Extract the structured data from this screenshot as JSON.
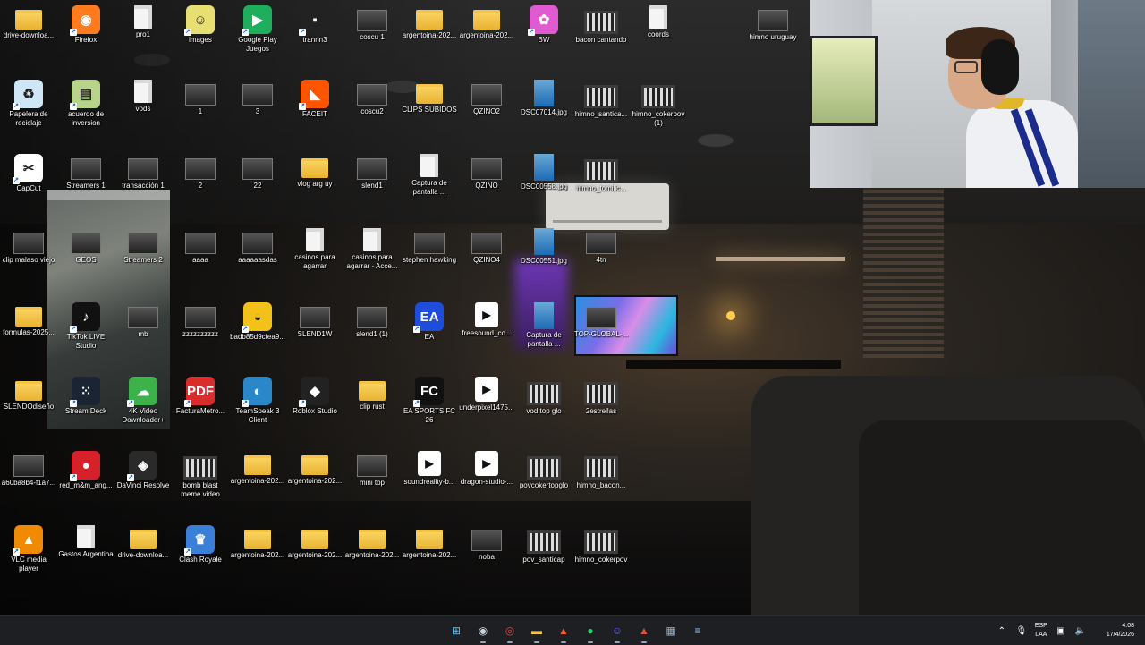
{
  "desktop": {
    "icons": [
      {
        "label": "drive-downloa...",
        "type": "folder"
      },
      {
        "label": "Firefox",
        "type": "app",
        "icon": "firefox-icon",
        "color": "#ff7b1f"
      },
      {
        "label": "pro1",
        "type": "file"
      },
      {
        "label": "images",
        "type": "app",
        "icon": "images-icon",
        "color": "#e8df72"
      },
      {
        "label": "Google Play Juegos",
        "type": "app",
        "icon": "google-play-games-icon",
        "color": "#1fae5c"
      },
      {
        "label": "trannn3",
        "type": "app",
        "icon": "trannn3-icon",
        "color": "#222"
      },
      {
        "label": "coscu 1",
        "type": "thumb"
      },
      {
        "label": "argentoina-202...",
        "type": "folder"
      },
      {
        "label": "argentoina-202...",
        "type": "folder"
      },
      {
        "label": "BW",
        "type": "app",
        "icon": "bw-icon",
        "color": "#e05ad1"
      },
      {
        "label": "bacon cantando",
        "type": "video"
      },
      {
        "label": "coords",
        "type": "file"
      },
      {
        "label": "himno uruguay",
        "type": "thumb"
      },
      {
        "label": "Papelera de reciclaje",
        "type": "app",
        "icon": "recycle-bin-icon",
        "color": "#cfe6f6"
      },
      {
        "label": "acuerdo de inversion",
        "type": "app",
        "icon": "document-icon",
        "color": "#b8d38a"
      },
      {
        "label": "vods",
        "type": "file"
      },
      {
        "label": "1",
        "type": "thumb"
      },
      {
        "label": "3",
        "type": "thumb"
      },
      {
        "label": "FACEIT",
        "type": "app",
        "icon": "faceit-icon",
        "color": "#ff5500"
      },
      {
        "label": "coscu2",
        "type": "thumb"
      },
      {
        "label": "CLIPS SUBIDOS",
        "type": "folder"
      },
      {
        "label": "QZINO2",
        "type": "thumb"
      },
      {
        "label": "DSC07014.jpg",
        "type": "photo"
      },
      {
        "label": "himno_santica...",
        "type": "video"
      },
      {
        "label": "himno_cokerpov (1)",
        "type": "video"
      },
      {
        "label": "CapCut",
        "type": "app",
        "icon": "capcut-icon",
        "color": "#ffffff"
      },
      {
        "label": "Streamers 1",
        "type": "thumb"
      },
      {
        "label": "transacción 1",
        "type": "thumb"
      },
      {
        "label": "2",
        "type": "thumb"
      },
      {
        "label": "22",
        "type": "thumb"
      },
      {
        "label": "vlog arg uy",
        "type": "folder"
      },
      {
        "label": "slend1",
        "type": "thumb"
      },
      {
        "label": "Captura de pantalla ...",
        "type": "file"
      },
      {
        "label": "QZINO",
        "type": "thumb"
      },
      {
        "label": "DSC00558.jpg",
        "type": "photo"
      },
      {
        "label": "himno_tomilic...",
        "type": "video"
      },
      {
        "label": "clip malaso viejo",
        "type": "thumb"
      },
      {
        "label": "GEOS",
        "type": "thumb"
      },
      {
        "label": "Streamers 2",
        "type": "thumb"
      },
      {
        "label": "aaaa",
        "type": "thumb"
      },
      {
        "label": "aaaaaasdas",
        "type": "thumb"
      },
      {
        "label": "casinos para agarrar",
        "type": "file"
      },
      {
        "label": "casinos para agarrar - Acce...",
        "type": "file"
      },
      {
        "label": "stephen hawking",
        "type": "thumb"
      },
      {
        "label": "QZINO4",
        "type": "thumb"
      },
      {
        "label": "DSC00551.jpg",
        "type": "photo"
      },
      {
        "label": "4tn",
        "type": "thumb"
      },
      {
        "label": "formulas-2025...",
        "type": "folder"
      },
      {
        "label": "TikTok LIVE Studio",
        "type": "app",
        "icon": "tiktok-icon",
        "color": "#111"
      },
      {
        "label": "mb",
        "type": "thumb"
      },
      {
        "label": "zzzzzzzzzz",
        "type": "thumb"
      },
      {
        "label": "badb85d9cfea9...",
        "type": "app",
        "icon": "helmet-icon",
        "color": "#f2c21b"
      },
      {
        "label": "SLEND1W",
        "type": "thumb"
      },
      {
        "label": "slend1 (1)",
        "type": "thumb"
      },
      {
        "label": "EA",
        "type": "app",
        "icon": "ea-icon",
        "color": "#1f4ddb"
      },
      {
        "label": "freesound_co...",
        "type": "media"
      },
      {
        "label": "Captura de pantalla ...",
        "type": "photo"
      },
      {
        "label": "TOP-GLOBAL-...",
        "type": "thumb"
      },
      {
        "label": "SLENDOdiseño",
        "type": "folder"
      },
      {
        "label": "Stream Deck",
        "type": "app",
        "icon": "stream-deck-icon",
        "color": "#1a2433"
      },
      {
        "label": "4K Video Downloader+",
        "type": "app",
        "icon": "download-cloud-icon",
        "color": "#3db24a"
      },
      {
        "label": "FacturaMetro...",
        "type": "app",
        "icon": "pdf-icon",
        "color": "#d92c2c"
      },
      {
        "label": "TeamSpeak 3 Client",
        "type": "app",
        "icon": "teamspeak-icon",
        "color": "#2a88c8"
      },
      {
        "label": "Roblox Studio",
        "type": "app",
        "icon": "roblox-icon",
        "color": "#222"
      },
      {
        "label": "clip rust",
        "type": "folder"
      },
      {
        "label": "EA SPORTS FC 26",
        "type": "app",
        "icon": "fc26-icon",
        "color": "#111"
      },
      {
        "label": "underpixel1475...",
        "type": "media"
      },
      {
        "label": "vod top glo",
        "type": "video"
      },
      {
        "label": "2estrellas",
        "type": "video"
      },
      {
        "label": "a60ba8b4-f1a7...",
        "type": "thumb"
      },
      {
        "label": "red_m&m_ang...",
        "type": "app",
        "icon": "mm-icon",
        "color": "#d6212b"
      },
      {
        "label": "DaVinci Resolve",
        "type": "app",
        "icon": "davinci-icon",
        "color": "#2a2a2a"
      },
      {
        "label": "bomb blast meme video",
        "type": "video"
      },
      {
        "label": "argentoina-202...",
        "type": "folder"
      },
      {
        "label": "argentoina-202...",
        "type": "folder"
      },
      {
        "label": "mini top",
        "type": "thumb"
      },
      {
        "label": "soundreality-b...",
        "type": "media"
      },
      {
        "label": "dragon-studio-...",
        "type": "media"
      },
      {
        "label": "povcokertopglo",
        "type": "video"
      },
      {
        "label": "himno_bacon...",
        "type": "video"
      },
      {
        "label": "VLC media player",
        "type": "app",
        "icon": "vlc-icon",
        "color": "#f08a00"
      },
      {
        "label": "Gastos Argentina",
        "type": "file"
      },
      {
        "label": "drive-downloa...",
        "type": "folder"
      },
      {
        "label": "Clash Royale",
        "type": "app",
        "icon": "clash-royale-icon",
        "color": "#3a7fd8"
      },
      {
        "label": "argentoina-202...",
        "type": "folder"
      },
      {
        "label": "argentoina-202...",
        "type": "folder"
      },
      {
        "label": "argentoina-202...",
        "type": "folder"
      },
      {
        "label": "argentoina-202...",
        "type": "folder"
      },
      {
        "label": "noba",
        "type": "thumb"
      },
      {
        "label": "pov_santicap",
        "type": "video"
      },
      {
        "label": "himno_cokerpov",
        "type": "video"
      }
    ]
  },
  "taskbar": {
    "apps": [
      {
        "name": "start-button",
        "glyph": "⊞",
        "color": "#4cc2ff"
      },
      {
        "name": "steam-icon",
        "glyph": "◉",
        "color": "#c7d5e0"
      },
      {
        "name": "chrome-icon",
        "glyph": "◎",
        "color": "#e8453c"
      },
      {
        "name": "file-explorer-icon",
        "glyph": "▬",
        "color": "#f4c542"
      },
      {
        "name": "brave-icon",
        "glyph": "▲",
        "color": "#fb542b"
      },
      {
        "name": "spotify-icon",
        "glyph": "●",
        "color": "#1ed760"
      },
      {
        "name": "discord-icon",
        "glyph": "☺",
        "color": "#5865f2"
      },
      {
        "name": "brave-beta-icon",
        "glyph": "▲",
        "color": "#e0523a"
      },
      {
        "name": "calculator-icon",
        "glyph": "▦",
        "color": "#9fb3c8"
      },
      {
        "name": "notepad-icon",
        "glyph": "≡",
        "color": "#8fd0f0"
      }
    ],
    "tray": {
      "lang_top": "ESP",
      "lang_bottom": "LAA",
      "time": "4:08",
      "date": "17/4/2026"
    }
  }
}
